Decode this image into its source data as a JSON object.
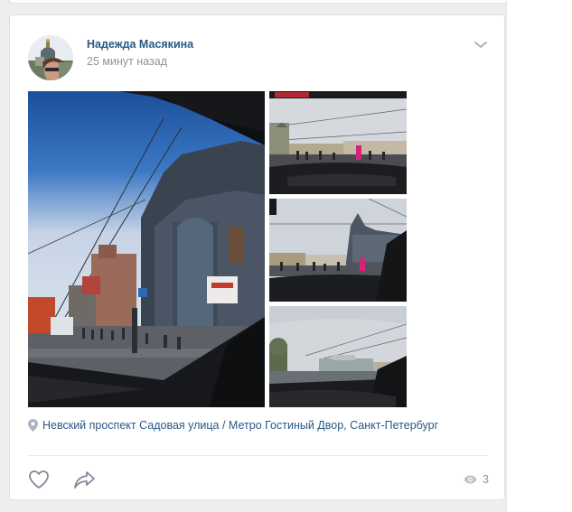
{
  "post": {
    "author_name": "Надежда Масякина",
    "time_ago": "25 минут назад",
    "location_text": "Невский проспект Садовая улица / Метро Гостиный Двор, Санкт-Петербург",
    "views_count": "3"
  },
  "icons": {
    "menu": "chevron-down-icon",
    "location": "map-pin-icon",
    "like": "heart-icon",
    "share": "share-arrow-icon",
    "views": "eye-icon"
  },
  "colors": {
    "link": "#2a5885",
    "muted": "#939393",
    "icon": "#828a99",
    "page_background": "#edeef0"
  }
}
